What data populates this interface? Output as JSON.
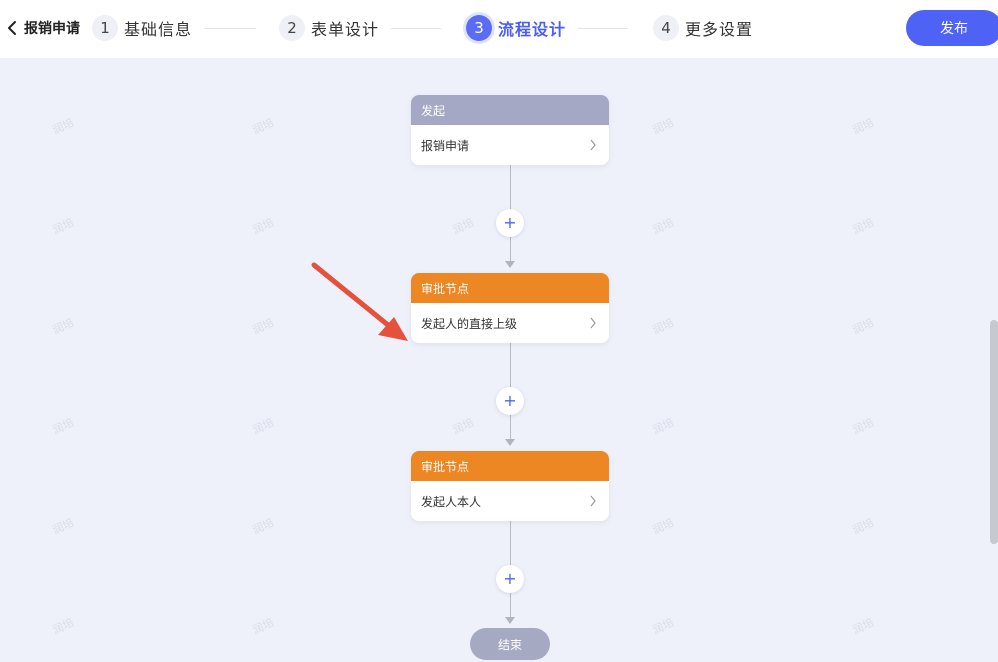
{
  "header": {
    "back_title": "报销申请",
    "steps": [
      {
        "num": "1",
        "label": "基础信息"
      },
      {
        "num": "2",
        "label": "表单设计"
      },
      {
        "num": "3",
        "label": "流程设计"
      },
      {
        "num": "4",
        "label": "更多设置"
      }
    ],
    "active_step": 3,
    "publish_label": "发布"
  },
  "flow": {
    "nodes": [
      {
        "type": "发起",
        "detail": "报销申请",
        "color": "#a4a8c4"
      },
      {
        "type": "审批节点",
        "detail": "发起人的直接上级",
        "color": "#ec8723"
      },
      {
        "type": "审批节点",
        "detail": "发起人本人",
        "color": "#ec8723"
      }
    ],
    "add_symbol": "+",
    "end_label": "结束"
  },
  "watermark": "润培",
  "colors": {
    "accent": "#4e63f5",
    "background": "#eff1fa",
    "start_node": "#a4a8c4",
    "approval_node": "#ec8723",
    "annotation_arrow": "#e5513d"
  }
}
